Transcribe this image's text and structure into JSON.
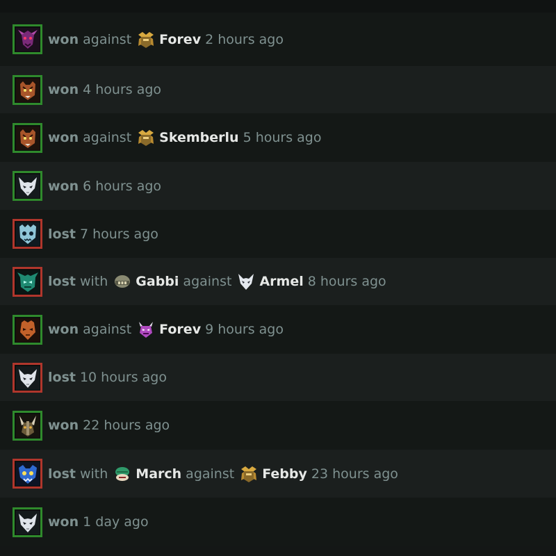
{
  "colors": {
    "win_border": "#2f8a2c",
    "loss_border": "#b0362c",
    "name_text": "#e6e8e6",
    "muted_text": "#7f9190"
  },
  "matches": [
    {
      "hero_icon": "purple-dragon-hero-icon",
      "result": "won",
      "with": null,
      "against": {
        "word": "against",
        "icon": "gold-samurai-rank-icon",
        "name": "Forev"
      },
      "time": "2 hours ago"
    },
    {
      "hero_icon": "tiger-hero-icon",
      "result": "won",
      "with": null,
      "against": null,
      "time": "4 hours ago"
    },
    {
      "hero_icon": "tiger-hero-icon",
      "result": "won",
      "with": null,
      "against": {
        "word": "against",
        "icon": "gold-samurai-rank-icon",
        "name": "Skemberlu"
      },
      "time": "5 hours ago"
    },
    {
      "hero_icon": "white-mask-hero-icon",
      "result": "won",
      "with": null,
      "against": null,
      "time": "6 hours ago"
    },
    {
      "hero_icon": "ice-skull-hero-icon",
      "result": "lost",
      "with": null,
      "against": null,
      "time": "7 hours ago"
    },
    {
      "hero_icon": "green-armor-hero-icon",
      "result": "lost",
      "with": {
        "word": "with",
        "icon": "stone-helm-rank-icon",
        "name": "Gabbi"
      },
      "against": {
        "word": "against",
        "icon": "white-mask-rank-icon",
        "name": "Armel"
      },
      "time": "8 hours ago"
    },
    {
      "hero_icon": "orange-mask-hero-icon",
      "result": "won",
      "with": null,
      "against": {
        "word": "against",
        "icon": "purple-demon-rank-icon",
        "name": "Forev"
      },
      "time": "9 hours ago"
    },
    {
      "hero_icon": "white-mask-hero-icon",
      "result": "lost",
      "with": null,
      "against": null,
      "time": "10 hours ago"
    },
    {
      "hero_icon": "horned-warrior-hero-icon",
      "result": "won",
      "with": null,
      "against": null,
      "time": "22 hours ago"
    },
    {
      "hero_icon": "blue-beast-hero-icon",
      "result": "lost",
      "with": {
        "word": "with",
        "icon": "green-turtle-rank-icon",
        "name": "March"
      },
      "against": {
        "word": "against",
        "icon": "gold-samurai-rank-icon",
        "name": "Febby"
      },
      "time": "23 hours ago"
    },
    {
      "hero_icon": "white-mask-hero-icon",
      "result": "won",
      "with": null,
      "against": null,
      "time": "1 day ago"
    }
  ]
}
